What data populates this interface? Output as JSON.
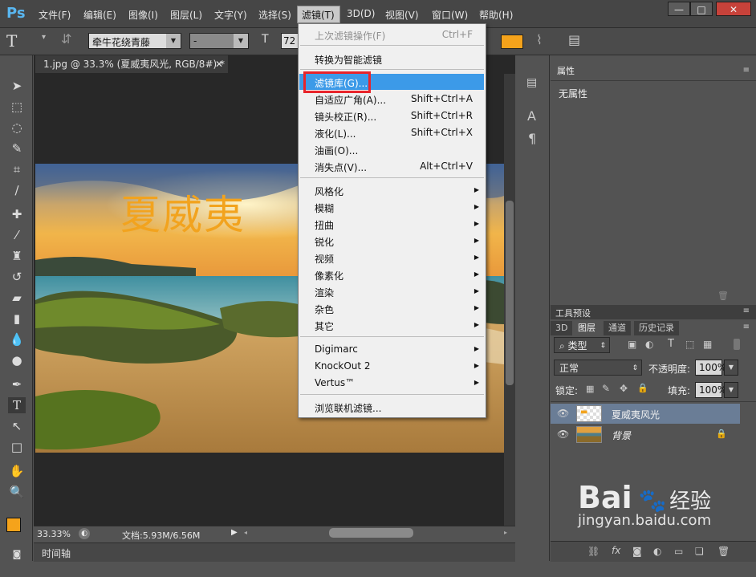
{
  "app": {
    "logo": "Ps"
  },
  "menubar": {
    "items": [
      "文件(F)",
      "编辑(E)",
      "图像(I)",
      "图层(L)",
      "文字(Y)",
      "选择(S)",
      "滤镜(T)",
      "3D(D)",
      "视图(V)",
      "窗口(W)",
      "帮助(H)"
    ],
    "window_buttons": [
      "—",
      "□",
      "✕"
    ]
  },
  "options": {
    "font_family": "牵牛花绕青藤",
    "font_style": "-",
    "font_size": "72",
    "accent_color": "#f5a31b"
  },
  "document": {
    "tab_title": "1.jpg @ 33.3% (夏威夷风光, RGB/8#) *",
    "overlay_text": "夏威夷",
    "zoom": "33.33%",
    "doc_size": "文档:5.93M/6.56M"
  },
  "timeline": {
    "label": "时间轴"
  },
  "filter_menu": {
    "items": [
      {
        "label": "上次滤镜操作(F)",
        "shortcut": "Ctrl+F",
        "disabled": true
      },
      {
        "label": "转换为智能滤镜"
      },
      {
        "label": "滤镜库(G)...",
        "highlighted": true
      },
      {
        "label": "自适应广角(A)...",
        "shortcut": "Shift+Ctrl+A"
      },
      {
        "label": "镜头校正(R)...",
        "shortcut": "Shift+Ctrl+R"
      },
      {
        "label": "液化(L)...",
        "shortcut": "Shift+Ctrl+X"
      },
      {
        "label": "油画(O)..."
      },
      {
        "label": "消失点(V)...",
        "shortcut": "Alt+Ctrl+V"
      },
      {
        "label": "风格化",
        "submenu": true
      },
      {
        "label": "模糊",
        "submenu": true
      },
      {
        "label": "扭曲",
        "submenu": true
      },
      {
        "label": "锐化",
        "submenu": true
      },
      {
        "label": "视频",
        "submenu": true
      },
      {
        "label": "像素化",
        "submenu": true
      },
      {
        "label": "渲染",
        "submenu": true
      },
      {
        "label": "杂色",
        "submenu": true
      },
      {
        "label": "其它",
        "submenu": true
      },
      {
        "label": "Digimarc",
        "submenu": true
      },
      {
        "label": "KnockOut 2",
        "submenu": true
      },
      {
        "label": "Vertus™",
        "submenu": true
      },
      {
        "label": "浏览联机滤镜..."
      }
    ],
    "highlight_color": "#3c9ae8",
    "callout_color": "#e8242b"
  },
  "properties_panel": {
    "tab": "属性",
    "content": "无属性"
  },
  "tool_presets": {
    "tab": "工具预设"
  },
  "layers_panel": {
    "tabs": [
      "3D",
      "图层",
      "通道",
      "历史记录"
    ],
    "active_tab": "图层",
    "filter_kind": "类型",
    "blend_mode": "正常",
    "opacity_label": "不透明度:",
    "opacity": "100%",
    "lock_label": "锁定:",
    "fill_label": "填充:",
    "fill": "100%",
    "layers": [
      {
        "name": "夏威夷风光",
        "selected": true
      },
      {
        "name": "背景",
        "locked": true
      }
    ]
  },
  "watermark": {
    "brand": "Bai",
    "brand2": "经验",
    "url": "jingyan.baidu.com"
  }
}
